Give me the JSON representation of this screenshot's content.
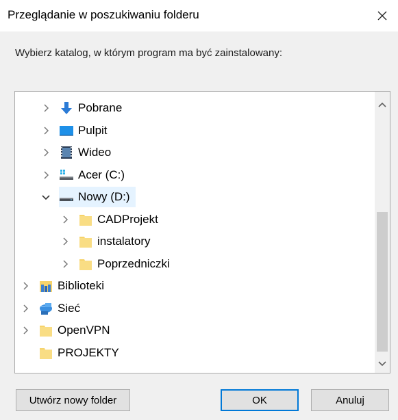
{
  "window": {
    "title": "Przeglądanie w poszukiwaniu folderu"
  },
  "prompt": "Wybierz katalog, w którym program ma być zainstalowany:",
  "tree": {
    "items": [
      {
        "label": "Pobrane",
        "icon": "download-arrow-icon",
        "expander": "collapsed",
        "selected": false
      },
      {
        "label": "Pulpit",
        "icon": "desktop-icon",
        "expander": "collapsed",
        "selected": false
      },
      {
        "label": "Wideo",
        "icon": "video-icon",
        "expander": "collapsed",
        "selected": false
      },
      {
        "label": "Acer (C:)",
        "icon": "system-drive-icon",
        "expander": "collapsed",
        "selected": false
      },
      {
        "label": "Nowy (D:)",
        "icon": "drive-icon",
        "expander": "expanded",
        "selected": true
      },
      {
        "label": "CADProjekt",
        "icon": "folder-icon",
        "expander": "collapsed",
        "selected": false
      },
      {
        "label": "instalatory",
        "icon": "folder-icon",
        "expander": "collapsed",
        "selected": false
      },
      {
        "label": "Poprzedniczki",
        "icon": "folder-icon",
        "expander": "collapsed",
        "selected": false
      },
      {
        "label": "Biblioteki",
        "icon": "libraries-icon",
        "expander": "collapsed",
        "selected": false
      },
      {
        "label": "Sieć",
        "icon": "network-icon",
        "expander": "collapsed",
        "selected": false
      },
      {
        "label": "OpenVPN",
        "icon": "folder-icon",
        "expander": "collapsed",
        "selected": false
      },
      {
        "label": "PROJEKTY",
        "icon": "folder-icon",
        "expander": "none",
        "selected": false
      }
    ]
  },
  "buttons": {
    "new_folder": "Utwórz nowy folder",
    "ok": "OK",
    "cancel": "Anuluj"
  },
  "colors": {
    "selection": "#e5f3ff",
    "folder": "#f6d36b",
    "accent": "#0078d7"
  }
}
